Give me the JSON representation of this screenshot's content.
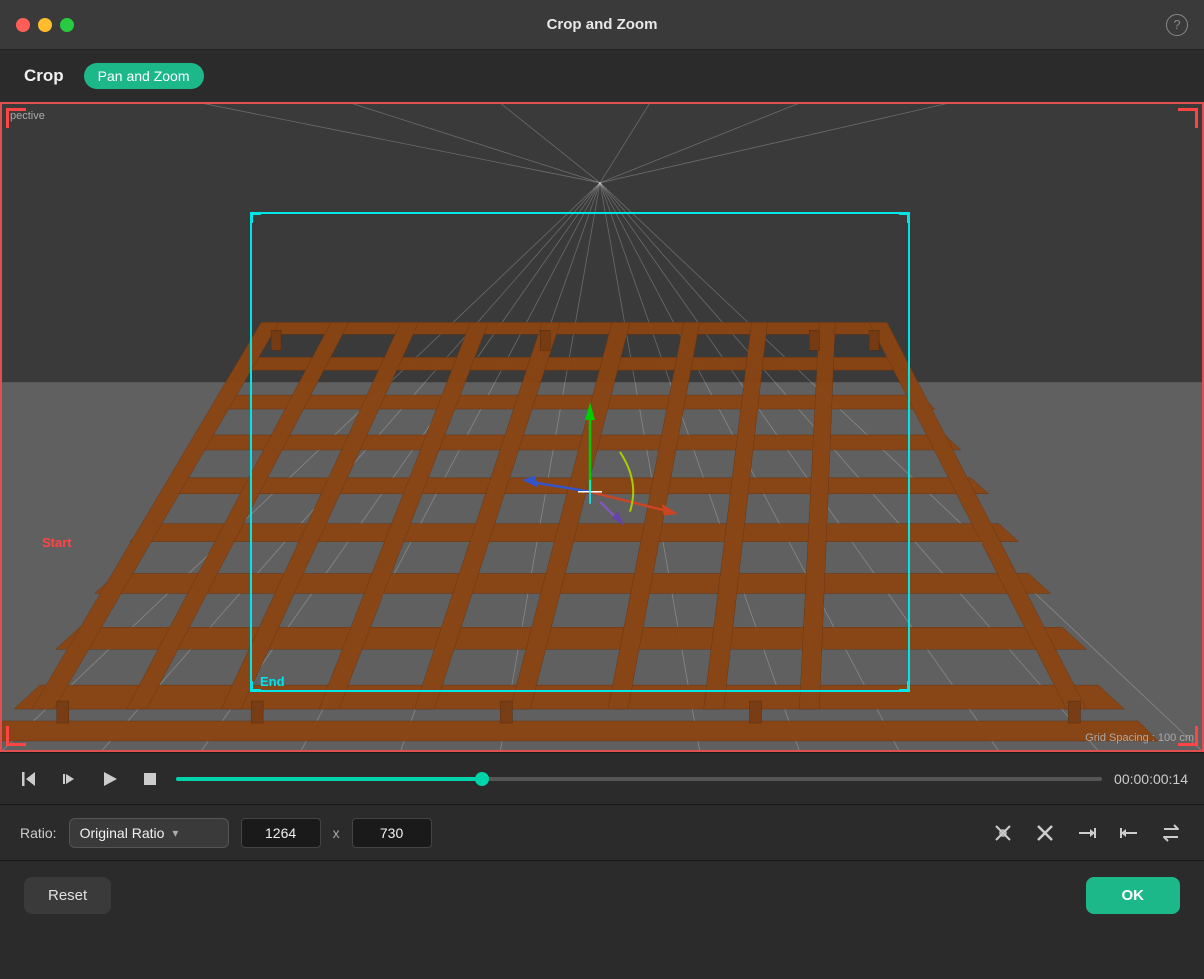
{
  "titlebar": {
    "title": "Crop and Zoom",
    "help_symbol": "?"
  },
  "tabs": {
    "crop_label": "Crop",
    "pan_zoom_label": "Pan and Zoom"
  },
  "scene": {
    "perspective_label": "pective",
    "grid_spacing": "Grid Spacing : 100 cm",
    "label_start": "Start",
    "label_end": "End"
  },
  "transport": {
    "timecode": "00:00:00:14"
  },
  "ratio": {
    "label": "Ratio:",
    "selected": "Original Ratio",
    "width": "1264",
    "x_label": "x",
    "height": "730"
  },
  "actions": {
    "reset_label": "Reset",
    "ok_label": "OK"
  },
  "icons": {
    "crop_symbol": "⚙",
    "back_step": "⊣",
    "step_fwd": "⊢",
    "play": "▷",
    "stop": "□"
  }
}
